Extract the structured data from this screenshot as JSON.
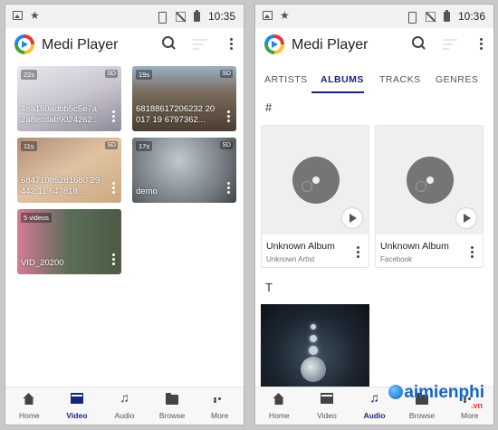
{
  "status_left": {
    "time": "10:35"
  },
  "status_right": {
    "time": "10:36"
  },
  "app": {
    "title": "Medi Player"
  },
  "videos": [
    {
      "duration": "22s",
      "quality": "SD",
      "name": "4ea150adbb5c5e7a 2a8ecdab9024262..."
    },
    {
      "duration": "19s",
      "quality": "SD",
      "name": "68188617206232 20017 19 6797362..."
    },
    {
      "duration": "11s",
      "quality": "SD",
      "name": "68471085281680 29442 11 647818..."
    },
    {
      "duration": "17s",
      "quality": "SD",
      "name": "demo"
    },
    {
      "duration": "5 videos",
      "quality": "",
      "name": "VID_20200"
    }
  ],
  "bottom_nav": [
    {
      "label": "Home"
    },
    {
      "label": "Video"
    },
    {
      "label": "Audio"
    },
    {
      "label": "Browse"
    },
    {
      "label": "More"
    }
  ],
  "tabs": [
    "ARTISTS",
    "ALBUMS",
    "TRACKS",
    "GENRES"
  ],
  "active_tab": "ALBUMS",
  "sections": {
    "hash": "#",
    "t": "T"
  },
  "albums": [
    {
      "title": "Unknown Album",
      "subtitle": "Unknown Artist"
    },
    {
      "title": "Unknown Album",
      "subtitle": "Facebook"
    }
  ],
  "watermark": {
    "main": "aimienphi",
    "sub": ".vn"
  },
  "colors": {
    "accent": "#1a237e",
    "disc": "#757575",
    "statusbar": "#f1f1f1"
  }
}
